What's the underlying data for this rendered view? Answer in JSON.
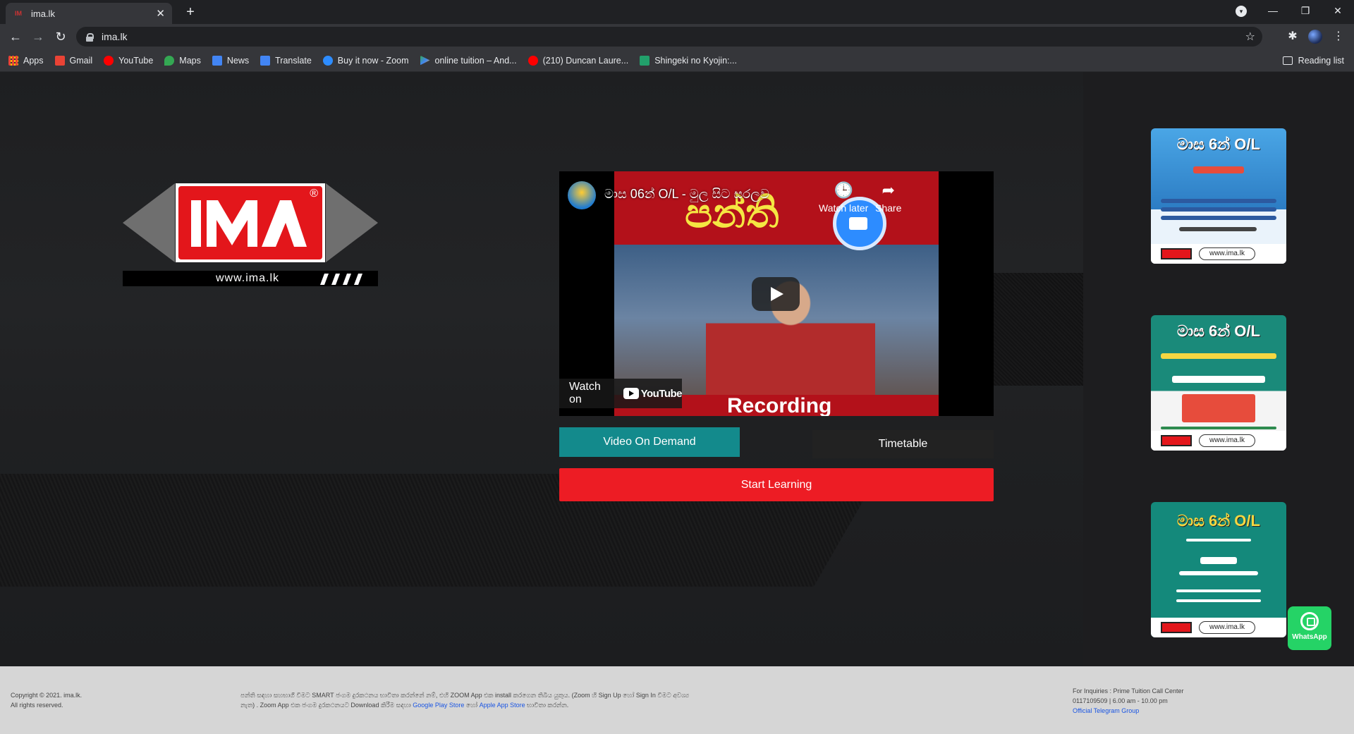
{
  "browser": {
    "tab_title": "ima.lk",
    "url": "ima.lk",
    "bookmarks": [
      {
        "label": "Apps",
        "color": "#4285f4"
      },
      {
        "label": "Gmail",
        "color": "#ea4335"
      },
      {
        "label": "YouTube",
        "color": "#ff0000"
      },
      {
        "label": "Maps",
        "color": "#34a853"
      },
      {
        "label": "News",
        "color": "#4285f4"
      },
      {
        "label": "Translate",
        "color": "#4285f4"
      },
      {
        "label": "Buy it now - Zoom",
        "color": "#2d8cff"
      },
      {
        "label": "online tuition – And...",
        "color": "#34a853"
      },
      {
        "label": "(210) Duncan Laure...",
        "color": "#ff0000"
      },
      {
        "label": "Shingeki no Kyojin:...",
        "color": "#22a06b"
      }
    ],
    "reading_list": "Reading list"
  },
  "logo": {
    "url_text": "www.ima.lk",
    "reg_mark": "®",
    "brand": "IMA"
  },
  "video": {
    "title": "මාස 06න් O/L - මුල සිට සරලව",
    "frame_text": "පන්ති",
    "recording_text": "Recording",
    "watch_later": "Watch later",
    "share": "Share",
    "watch_on": "Watch on",
    "youtube": "YouTube"
  },
  "buttons": {
    "video_on_demand": "Video On Demand",
    "timetable": "Timetable",
    "start_learning": "Start Learning"
  },
  "posters": [
    {
      "title": "මාස 6න් O/L",
      "web": "www.ima.lk",
      "bg": "#3a8ed0"
    },
    {
      "title": "මාස 6න් O/L",
      "web": "www.ima.lk",
      "bg": "#1a8a7a"
    },
    {
      "title": "මාස 6න් O/L",
      "web": "www.ima.lk",
      "bg": "#14897b"
    }
  ],
  "footer": {
    "copyright": "Copyright © 2021. ima.lk.",
    "rights": "All rights reserved.",
    "info_text": "පන්ති සඳහා සහභාගී වීමට SMART ජංගම දුරකථනය භාවිතා කරන්නේ නම්, එහි ZOOM App එක install කරගෙන තිබිය යුතුය. (Zoom හි Sign Up හෝ Sign In වීමට අවශ්‍ය නැත) . Zoom App එක ජංගම දුරකථනයට Download කිරීම සඳහා",
    "google_play": "Google Play Store",
    "or": "හෝ",
    "apple": "Apple App Store",
    "use": "භාවිතා කරන්න.",
    "inquiries": "For Inquiries : Prime Tuition Call Center",
    "phone_hours": "0117109509 | 6.00 am - 10.00 pm",
    "telegram": "Official Telegram Group",
    "whatsapp": "WhatsApp"
  }
}
